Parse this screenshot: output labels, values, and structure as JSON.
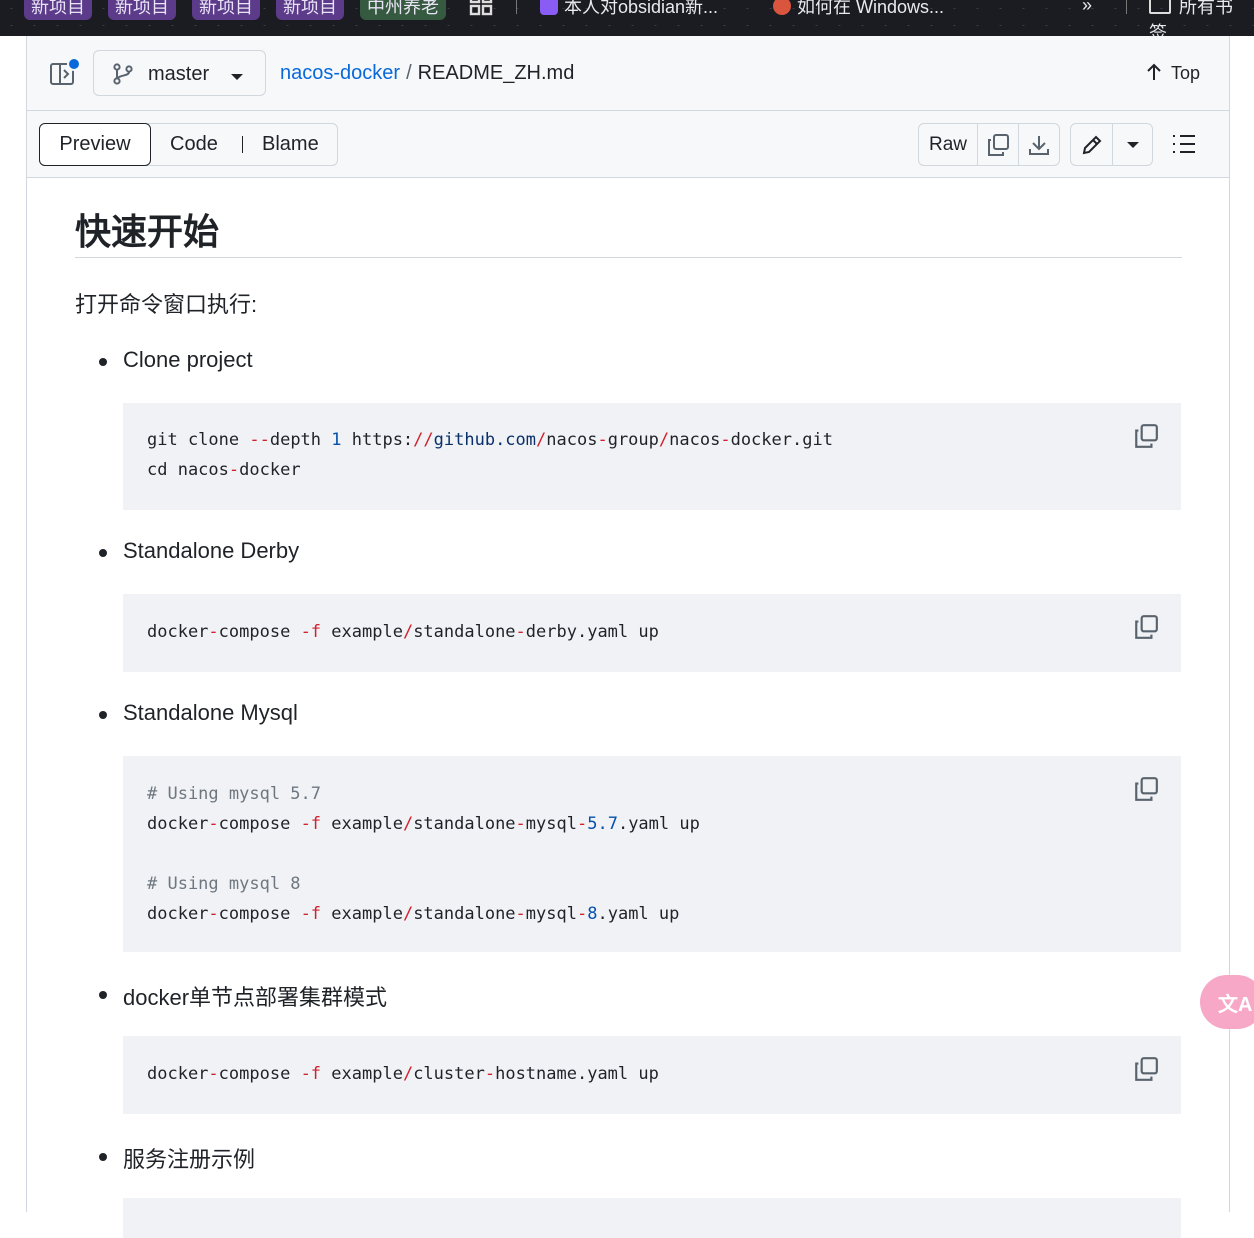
{
  "bookmarks": [
    {
      "label": "新项目",
      "style": "purple"
    },
    {
      "label": "新项目",
      "style": "purple"
    },
    {
      "label": "新项目",
      "style": "purple"
    },
    {
      "label": "新项目",
      "style": "purple"
    },
    {
      "label": "中州养老",
      "style": "green"
    },
    {
      "label": "本人对obsidian新...",
      "style": "plain"
    },
    {
      "label": "如何在 Windows...",
      "style": "plain"
    },
    {
      "label": "所有书签",
      "style": "plain"
    }
  ],
  "header": {
    "branch": "master",
    "repo": "nacos-docker",
    "separator": "/",
    "file": "README_ZH.md",
    "top_label": "Top"
  },
  "toolbar": {
    "tabs": [
      "Preview",
      "Code",
      "Blame"
    ],
    "raw_label": "Raw"
  },
  "content": {
    "title": "快速开始",
    "intro": "打开命令窗口执行:",
    "items": [
      {
        "label": "Clone project"
      },
      {
        "label": "Standalone Derby"
      },
      {
        "label": "Standalone Mysql"
      },
      {
        "label": "docker单节点部署集群模式"
      },
      {
        "label": "服务注册示例"
      }
    ]
  },
  "translate_label": "文A",
  "colors": {
    "link": "#0969da",
    "code_bg": "#f0f2f5",
    "header_bg": "#f6f8fa",
    "border": "#d0d7de",
    "keyword_red": "#cf222e",
    "number_blue": "#0550ae",
    "comment_gray": "#6e7781"
  }
}
